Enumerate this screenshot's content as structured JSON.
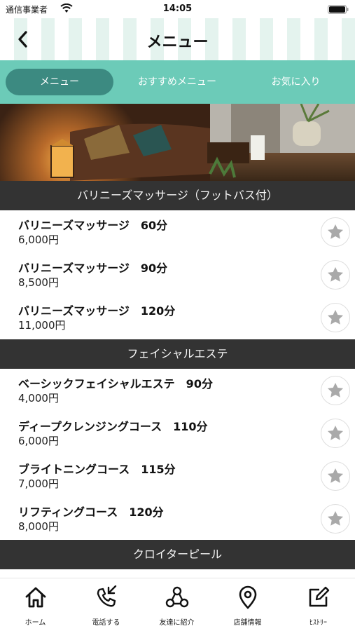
{
  "status_bar": {
    "carrier": "通信事業者",
    "time": "14:05"
  },
  "header": {
    "title": "メニュー"
  },
  "tabs": [
    {
      "label": "メニュー",
      "active": true
    },
    {
      "label": "おすすめメニュー",
      "active": false
    },
    {
      "label": "お気に入り",
      "active": false
    }
  ],
  "sections": [
    {
      "title": "バリニーズマッサージ（フットバス付）",
      "items": [
        {
          "name": "バリニーズマッサージ　60分",
          "price": "6,000円"
        },
        {
          "name": "バリニーズマッサージ　90分",
          "price": "8,500円"
        },
        {
          "name": "バリニーズマッサージ　120分",
          "price": "11,000円"
        }
      ]
    },
    {
      "title": "フェイシャルエステ",
      "items": [
        {
          "name": "ベーシックフェイシャルエステ　90分",
          "price": "4,000円"
        },
        {
          "name": "ディープクレンジングコース　110分",
          "price": "6,000円"
        },
        {
          "name": "ブライトニングコース　115分",
          "price": "7,000円"
        },
        {
          "name": "リフティングコース　120分",
          "price": "8,000円"
        }
      ]
    },
    {
      "title": "クロイターピール",
      "items": []
    }
  ],
  "bottom_nav": [
    {
      "label": "ホーム",
      "icon": "home-icon"
    },
    {
      "label": "電話する",
      "icon": "phone-icon"
    },
    {
      "label": "友達に紹介",
      "icon": "share-icon"
    },
    {
      "label": "店舗情報",
      "icon": "location-pin-icon"
    },
    {
      "label": "ﾋｽﾄﾘｰ",
      "icon": "edit-icon"
    }
  ],
  "colors": {
    "accent": "#6ccbb8",
    "tab_active": "#3c8a81",
    "section_bg": "#333333",
    "star": "#a9a9a9"
  }
}
